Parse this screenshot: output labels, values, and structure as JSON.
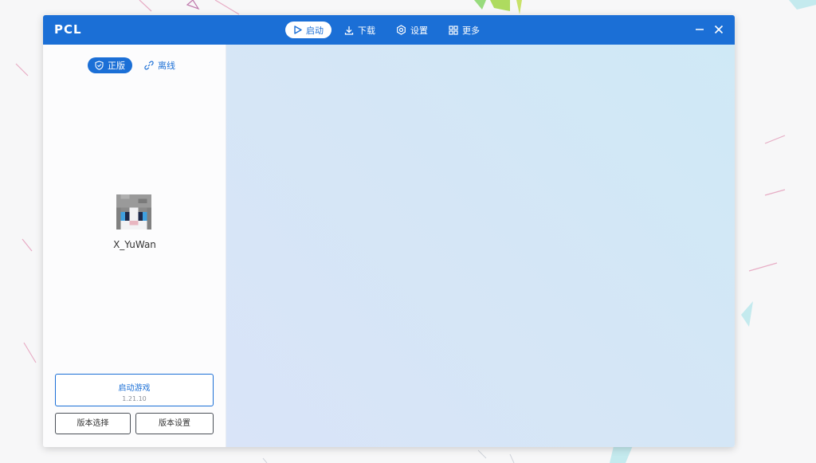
{
  "window": {
    "title": "PCL"
  },
  "nav": {
    "items": [
      {
        "label": "启动",
        "icon": "play-icon",
        "active": true
      },
      {
        "label": "下载",
        "icon": "download-icon",
        "active": false
      },
      {
        "label": "设置",
        "icon": "settings-icon",
        "active": false
      },
      {
        "label": "更多",
        "icon": "grid-icon",
        "active": false
      }
    ]
  },
  "controls": {
    "minimize_icon": "minimize-icon",
    "close_icon": "close-icon"
  },
  "sidebar": {
    "modes": [
      {
        "label": "正版",
        "icon": "shield-icon",
        "active": true
      },
      {
        "label": "离线",
        "icon": "link-icon",
        "active": false
      }
    ],
    "username": "X_YuWan",
    "launch": {
      "label": "启动游戏",
      "version": "1.21.10"
    },
    "version_select_label": "版本选择",
    "version_settings_label": "版本设置"
  },
  "colors": {
    "accent": "#1b6fd6",
    "titlebar": "#1b6fd6",
    "main_bg": "#d6e6f7"
  }
}
